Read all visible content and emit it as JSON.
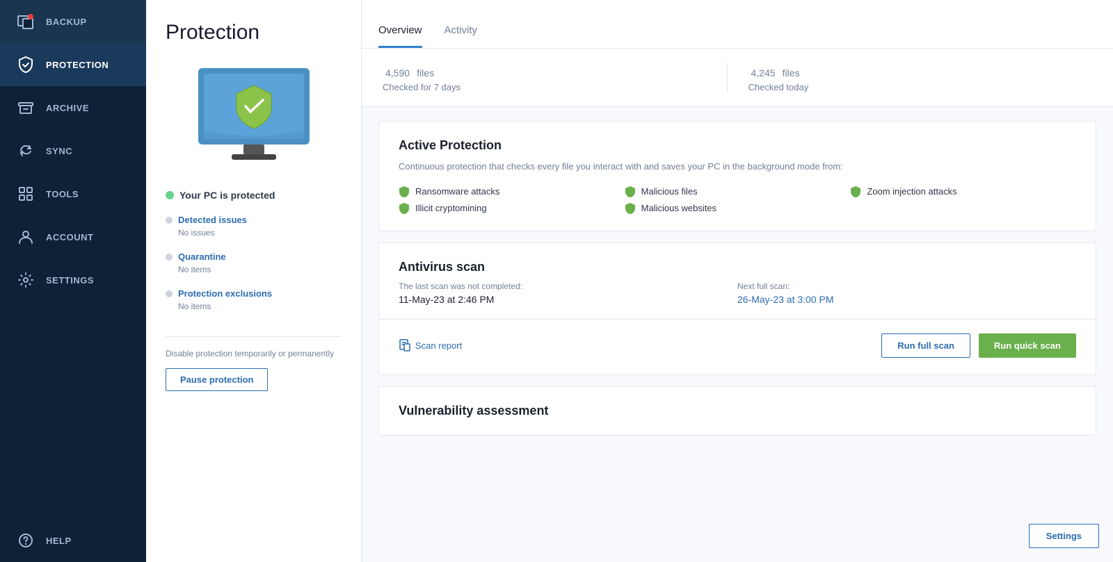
{
  "sidebar": {
    "items": [
      {
        "id": "backup",
        "label": "BACKUP",
        "icon": "backup-icon",
        "active": false
      },
      {
        "id": "protection",
        "label": "PROTECTION",
        "icon": "shield-icon",
        "active": true
      },
      {
        "id": "archive",
        "label": "ARCHIVE",
        "icon": "archive-icon",
        "active": false
      },
      {
        "id": "sync",
        "label": "SYNC",
        "icon": "sync-icon",
        "active": false
      },
      {
        "id": "tools",
        "label": "TOOLS",
        "icon": "tools-icon",
        "active": false
      },
      {
        "id": "account",
        "label": "ACCOUNT",
        "icon": "account-icon",
        "active": false
      },
      {
        "id": "settings",
        "label": "SETTINGS",
        "icon": "settings-icon",
        "active": false
      }
    ],
    "help_label": "HELP"
  },
  "page": {
    "title": "Protection"
  },
  "status": {
    "text": "Your PC is protected"
  },
  "side_links": [
    {
      "id": "detected-issues",
      "label": "Detected issues",
      "sub": "No issues"
    },
    {
      "id": "quarantine",
      "label": "Quarantine",
      "sub": "No items"
    },
    {
      "id": "protection-exclusions",
      "label": "Protection exclusions",
      "sub": "No items"
    }
  ],
  "disable_text": "Disable protection temporarily or permanently",
  "pause_btn": "Pause protection",
  "tabs": [
    {
      "id": "overview",
      "label": "Overview",
      "active": true
    },
    {
      "id": "activity",
      "label": "Activity",
      "active": false
    }
  ],
  "stats": [
    {
      "id": "files-7days",
      "number": "4,590",
      "unit": "files",
      "label": "Checked for 7 days"
    },
    {
      "id": "files-today",
      "number": "4,245",
      "unit": "files",
      "label": "Checked today"
    }
  ],
  "active_protection": {
    "title": "Active Protection",
    "description": "Continuous protection that checks every file you interact with and saves your PC in the background mode from:",
    "features": [
      "Ransomware attacks",
      "Malicious files",
      "Zoom injection attacks",
      "Illicit cryptomining",
      "Malicious websites"
    ]
  },
  "antivirus_scan": {
    "title": "Antivirus scan",
    "last_scan_label": "The last scan was not completed:",
    "last_scan_value": "11-May-23 at 2:46 PM",
    "next_scan_label": "Next full scan:",
    "next_scan_value": "26-May-23 at 3:00 PM",
    "report_label": "Scan report",
    "run_full_label": "Run full scan",
    "run_quick_label": "Run quick scan"
  },
  "vulnerability": {
    "title": "Vulnerability assessment"
  },
  "settings_btn": "Settings"
}
